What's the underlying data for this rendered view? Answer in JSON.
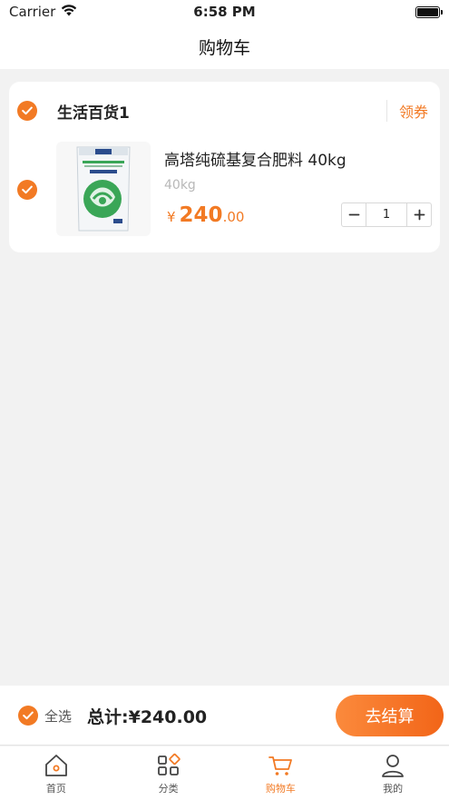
{
  "status_bar": {
    "carrier": "Carrier",
    "time": "6:58 PM",
    "icons": [
      "wifi-icon",
      "battery-icon"
    ]
  },
  "nav": {
    "title": "购物车"
  },
  "store": {
    "name": "生活百货1",
    "coupon_label": "领券",
    "checked": true
  },
  "item": {
    "title": "高塔纯硫基复合肥料 40kg",
    "spec": "40kg",
    "price_currency": "¥",
    "price_int": "240",
    "price_dec": ".00",
    "quantity": "1",
    "checked": true,
    "image_icon": "fertilizer-bag-image"
  },
  "checkout": {
    "select_all_label": "全选",
    "total_text": "总计:¥240.00",
    "button_label": "去结算"
  },
  "tabs": [
    {
      "label": "首页",
      "icon": "home-icon",
      "active": false
    },
    {
      "label": "分类",
      "icon": "category-icon",
      "active": false
    },
    {
      "label": "购物车",
      "icon": "cart-icon",
      "active": true
    },
    {
      "label": "我的",
      "icon": "user-icon",
      "active": false
    }
  ],
  "colors": {
    "accent": "#f27a24",
    "background": "#f2f2f2",
    "card": "#ffffff"
  }
}
